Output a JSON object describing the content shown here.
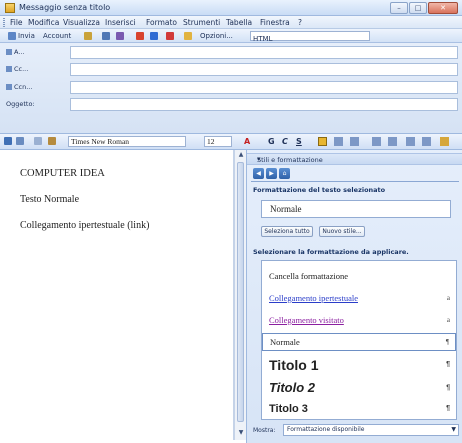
{
  "window": {
    "title": "Messaggio senza titolo",
    "buttons": [
      "–",
      "□",
      "✕"
    ]
  },
  "menu": [
    "File",
    "Modifica",
    "Visualizza",
    "Inserisci",
    "Formato",
    "Strumenti",
    "Tabella",
    "Finestra",
    "?"
  ],
  "toolbar": {
    "send": "Invia",
    "account": "Account",
    "options": "Opzioni...",
    "format": "HTML"
  },
  "headers": {
    "to": "A...",
    "cc": "Cc...",
    "bcc": "Ccn...",
    "subject": "Oggetto:"
  },
  "format_bar": {
    "font": "Times New Roman",
    "size": "12",
    "bold": "G",
    "italic": "C",
    "underline": "S"
  },
  "body": {
    "line1": "COMPUTER IDEA",
    "line2": "Testo Normale",
    "line3": "Collegamento ipertestuale (link)"
  },
  "pane": {
    "title": "Stili e formattazione",
    "selected_label": "Formattazione del testo selezionato",
    "current_style": "Normale",
    "select_all": "Seleziona tutto",
    "new_style": "Nuovo stile...",
    "apply_label": "Selezionare la formattazione da applicare.",
    "styles": {
      "clear": "Cancella formattazione",
      "link": "Collegamento ipertestuale",
      "visited": "Collegamento visitato",
      "normal": "Normale",
      "t1": "Titolo 1",
      "t2": "Titolo 2",
      "t3": "Titolo 3"
    },
    "style_marks": [
      "a",
      "a",
      "¶",
      "¶",
      "¶",
      "¶"
    ],
    "show_label": "Mostra:",
    "show_value": "Formattazione disponibile"
  },
  "colors": {
    "link": "#2a3dc9",
    "visited": "#8b1fa0",
    "chrome": "#d5e2f4"
  }
}
